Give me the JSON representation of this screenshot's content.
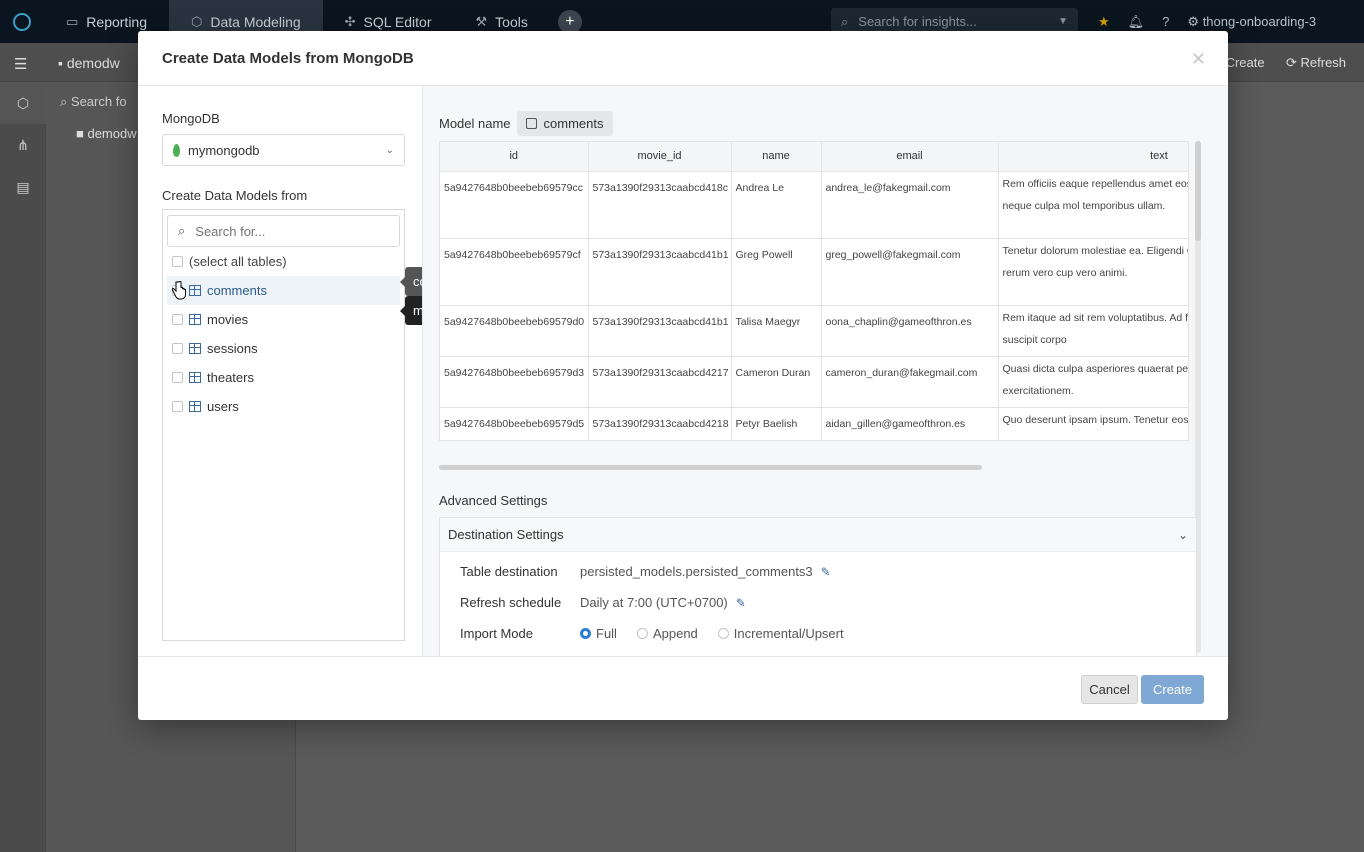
{
  "topbar": {
    "nav": [
      {
        "label": "Reporting",
        "icon": "file-icon"
      },
      {
        "label": "Data Modeling",
        "icon": "cube-icon"
      },
      {
        "label": "SQL Editor",
        "icon": "sql-icon"
      },
      {
        "label": "Tools",
        "icon": "wrench-icon"
      }
    ],
    "search_placeholder": "Search for insights...",
    "workspace": "thong-onboarding-3"
  },
  "subbar": {
    "crumb": "demodw",
    "create": "Create",
    "refresh": "Refresh"
  },
  "sidepanel": {
    "search": "Search fo",
    "folder": "demodw"
  },
  "modal": {
    "title": "Create Data Models from MongoDB",
    "source_label": "MongoDB",
    "source_value": "mymongodb",
    "from_label": "Create Data Models from",
    "table_search_placeholder": "Search for...",
    "select_all": "(select all tables)",
    "tables": [
      "comments",
      "movies",
      "sessions",
      "theaters",
      "users"
    ],
    "tooltips": [
      "comments",
      "movies"
    ],
    "model_name_label": "Model name",
    "model_name": "comments",
    "columns": [
      "id",
      "movie_id",
      "name",
      "email",
      "text"
    ],
    "rows": [
      [
        "5a9427648b0beebeb69579cc",
        "573a1390f29313caabcd418c",
        "Andrea Le",
        "andrea_le@fakegmail.com",
        "Rem officiis eaque repellendus amet eos voluptatum voluptates neque culpa mol temporibus ullam."
      ],
      [
        "5a9427648b0beebeb69579cf",
        "573a1390f29313caabcd41b1",
        "Greg Powell",
        "greg_powell@fakegmail.com",
        "Tenetur dolorum molestiae ea. Eligendi Commodi nisi sit placeat rerum vero cup vero animi."
      ],
      [
        "5a9427648b0beebeb69579d0",
        "573a1390f29313caabcd41b1",
        "Talisa Maegyr",
        "oona_chaplin@gameofthron.es",
        "Rem itaque ad sit rem voluptatibus. Ad f alias minus. Optio ratione suscipit corpo"
      ],
      [
        "5a9427648b0beebeb69579d3",
        "573a1390f29313caabcd4217",
        "Cameron Duran",
        "cameron_duran@fakegmail.com",
        "Quasi dicta culpa asperiores quaerat per pariatur impedit itaque exercitationem."
      ],
      [
        "5a9427648b0beebeb69579d5",
        "573a1390f29313caabcd4218",
        "Petyr Baelish",
        "aidan_gillen@gameofthron.es",
        "Quo deserunt ipsam ipsum. Tenetur eos minus exercitationem."
      ]
    ],
    "advanced_label": "Advanced Settings",
    "destination_header": "Destination Settings",
    "table_destination_label": "Table destination",
    "table_destination": "persisted_models.persisted_comments3",
    "refresh_schedule_label": "Refresh schedule",
    "refresh_schedule": "Daily at 7:00 (UTC+0700)",
    "import_mode_label": "Import Mode",
    "import_modes": [
      "Full",
      "Append",
      "Incremental/Upsert"
    ],
    "import_mode_selected": "Full",
    "cancel": "Cancel",
    "create": "Create"
  },
  "colors": {
    "primary": "#2b7cd3",
    "create_button": "#7fa9d4",
    "topbar": "#0b1520",
    "mongo_leaf": "#4caf50"
  }
}
